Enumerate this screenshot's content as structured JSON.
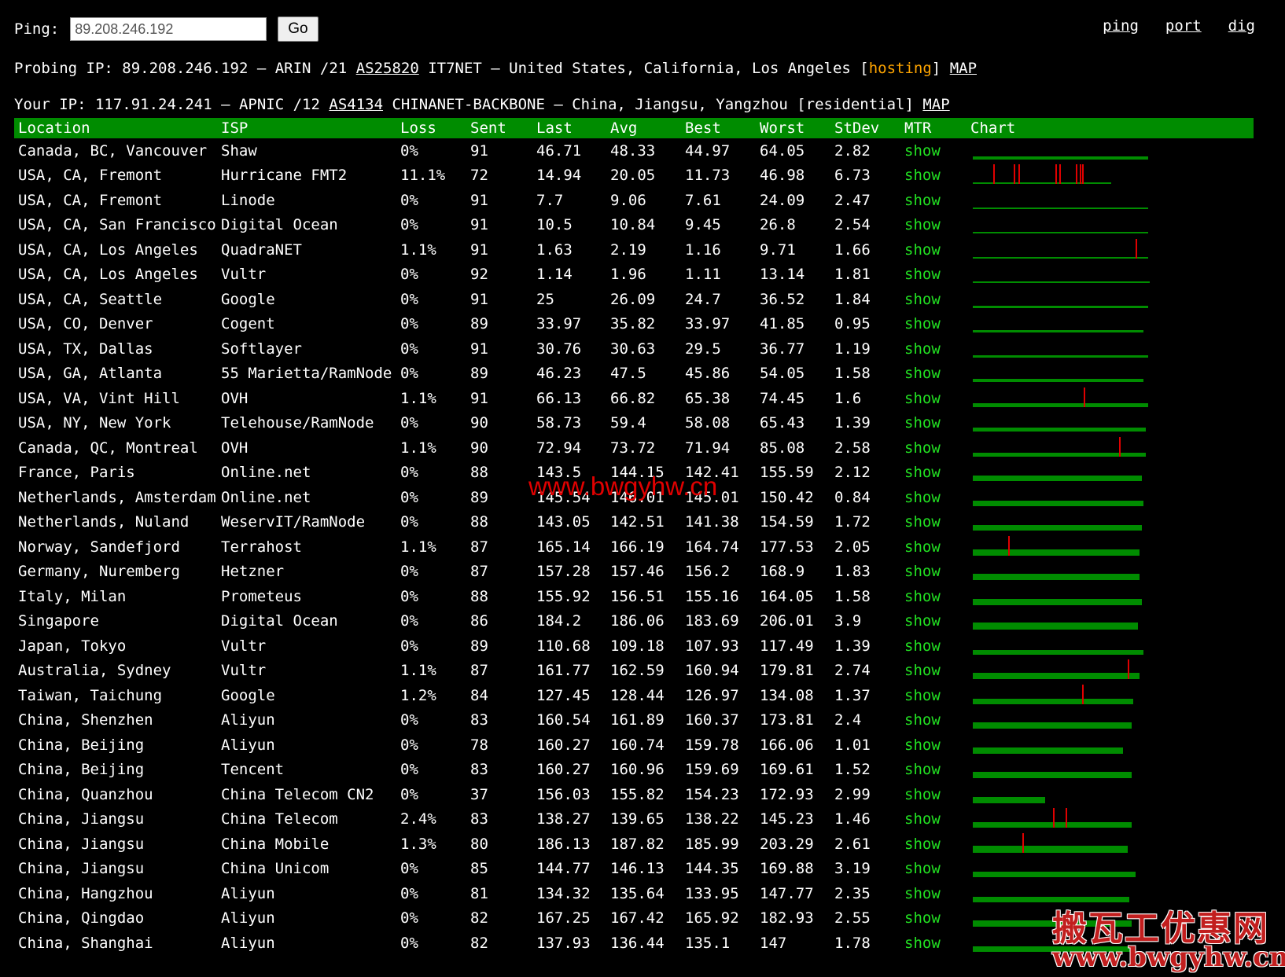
{
  "form": {
    "label": "Ping:",
    "input_value": "89.208.246.192",
    "go_label": "Go"
  },
  "nav": [
    "ping",
    "port",
    "dig"
  ],
  "probing": {
    "prefix": "Probing IP: 89.208.246.192 – ARIN /21 ",
    "as": "AS25820",
    "middle": " IT7NET – United States, California, Los Angeles [",
    "tag": "hosting",
    "after": "] ",
    "map": "MAP"
  },
  "your": {
    "prefix": "Your IP: 117.91.24.241 – APNIC /12 ",
    "as": "AS4134",
    "middle": " CHINANET-BACKBONE – China, Jiangsu, Yangzhou [residential] ",
    "map": "MAP"
  },
  "columns": [
    "Location",
    "ISP",
    "Loss",
    "Sent",
    "Last",
    "Avg",
    "Best",
    "Worst",
    "StDev",
    "MTR",
    "Chart"
  ],
  "colors": {
    "header_bg": "#008c00",
    "show_link": "#22e022",
    "chart_green": "#008c00",
    "chart_loss": "#e00000",
    "hosting": "#ffa500"
  },
  "rows": [
    {
      "location": "Canada, BC, Vancouver",
      "isp": "Shaw",
      "loss": "0%",
      "sent": "91",
      "last": "46.71",
      "avg": "48.33",
      "best": "44.97",
      "worst": "64.05",
      "stdev": "2.82",
      "mtr": "show",
      "chart": {
        "fill": 0.85,
        "thickness": 0.25,
        "spikes": []
      }
    },
    {
      "location": "USA, CA, Fremont",
      "isp": "Hurricane FMT2",
      "loss": "11.1%",
      "sent": "72",
      "last": "14.94",
      "avg": "20.05",
      "best": "11.73",
      "worst": "46.98",
      "stdev": "6.73",
      "mtr": "show",
      "chart": {
        "fill": 0.67,
        "thickness": 0.12,
        "spikes": [
          0.1,
          0.2,
          0.22,
          0.4,
          0.42,
          0.5,
          0.52,
          0.53
        ]
      }
    },
    {
      "location": "USA, CA, Fremont",
      "isp": "Linode",
      "loss": "0%",
      "sent": "91",
      "last": "7.7",
      "avg": "9.06",
      "best": "7.61",
      "worst": "24.09",
      "stdev": "2.47",
      "mtr": "show",
      "chart": {
        "fill": 0.85,
        "thickness": 0.08,
        "spikes": []
      }
    },
    {
      "location": "USA, CA, San Francisco",
      "isp": "Digital Ocean",
      "loss": "0%",
      "sent": "91",
      "last": "10.5",
      "avg": "10.84",
      "best": "9.45",
      "worst": "26.8",
      "stdev": "2.54",
      "mtr": "show",
      "chart": {
        "fill": 0.85,
        "thickness": 0.08,
        "spikes": []
      }
    },
    {
      "location": "USA, CA, Los Angeles",
      "isp": "QuadraNET",
      "loss": "1.1%",
      "sent": "91",
      "last": "1.63",
      "avg": "2.19",
      "best": "1.16",
      "worst": "9.71",
      "stdev": "1.66",
      "mtr": "show",
      "chart": {
        "fill": 0.85,
        "thickness": 0.06,
        "spikes": [
          0.79
        ]
      }
    },
    {
      "location": "USA, CA, Los Angeles",
      "isp": "Vultr",
      "loss": "0%",
      "sent": "92",
      "last": "1.14",
      "avg": "1.96",
      "best": "1.11",
      "worst": "13.14",
      "stdev": "1.81",
      "mtr": "show",
      "chart": {
        "fill": 0.86,
        "thickness": 0.06,
        "spikes": []
      }
    },
    {
      "location": "USA, CA, Seattle",
      "isp": "Google",
      "loss": "0%",
      "sent": "91",
      "last": "25",
      "avg": "26.09",
      "best": "24.7",
      "worst": "36.52",
      "stdev": "1.84",
      "mtr": "show",
      "chart": {
        "fill": 0.85,
        "thickness": 0.2,
        "spikes": []
      }
    },
    {
      "location": "USA, CO, Denver",
      "isp": "Cogent",
      "loss": "0%",
      "sent": "89",
      "last": "33.97",
      "avg": "35.82",
      "best": "33.97",
      "worst": "41.85",
      "stdev": "0.95",
      "mtr": "show",
      "chart": {
        "fill": 0.83,
        "thickness": 0.2,
        "spikes": []
      }
    },
    {
      "location": "USA, TX, Dallas",
      "isp": "Softlayer",
      "loss": "0%",
      "sent": "91",
      "last": "30.76",
      "avg": "30.63",
      "best": "29.5",
      "worst": "36.77",
      "stdev": "1.19",
      "mtr": "show",
      "chart": {
        "fill": 0.85,
        "thickness": 0.2,
        "spikes": []
      }
    },
    {
      "location": "USA, GA, Atlanta",
      "isp": "55 Marietta/RamNode",
      "loss": "0%",
      "sent": "89",
      "last": "46.23",
      "avg": "47.5",
      "best": "45.86",
      "worst": "54.05",
      "stdev": "1.58",
      "mtr": "show",
      "chart": {
        "fill": 0.83,
        "thickness": 0.25,
        "spikes": []
      }
    },
    {
      "location": "USA, VA, Vint Hill",
      "isp": "OVH",
      "loss": "1.1%",
      "sent": "91",
      "last": "66.13",
      "avg": "66.82",
      "best": "65.38",
      "worst": "74.45",
      "stdev": "1.6",
      "mtr": "show",
      "chart": {
        "fill": 0.85,
        "thickness": 0.3,
        "spikes": [
          0.54
        ]
      }
    },
    {
      "location": "USA, NY, New York",
      "isp": "Telehouse/RamNode",
      "loss": "0%",
      "sent": "90",
      "last": "58.73",
      "avg": "59.4",
      "best": "58.08",
      "worst": "65.43",
      "stdev": "1.39",
      "mtr": "show",
      "chart": {
        "fill": 0.84,
        "thickness": 0.3,
        "spikes": []
      }
    },
    {
      "location": "Canada, QC, Montreal",
      "isp": "OVH",
      "loss": "1.1%",
      "sent": "90",
      "last": "72.94",
      "avg": "73.72",
      "best": "71.94",
      "worst": "85.08",
      "stdev": "2.58",
      "mtr": "show",
      "chart": {
        "fill": 0.84,
        "thickness": 0.32,
        "spikes": [
          0.71
        ]
      }
    },
    {
      "location": "France, Paris",
      "isp": "Online.net",
      "loss": "0%",
      "sent": "88",
      "last": "143.5",
      "avg": "144.15",
      "best": "142.41",
      "worst": "155.59",
      "stdev": "2.12",
      "mtr": "show",
      "chart": {
        "fill": 0.82,
        "thickness": 0.45,
        "spikes": []
      }
    },
    {
      "location": "Netherlands, Amsterdam",
      "isp": "Online.net",
      "loss": "0%",
      "sent": "89",
      "last": "145.54",
      "avg": "146.01",
      "best": "145.01",
      "worst": "150.42",
      "stdev": "0.84",
      "mtr": "show",
      "chart": {
        "fill": 0.83,
        "thickness": 0.45,
        "spikes": []
      }
    },
    {
      "location": "Netherlands, Nuland",
      "isp": "WeservIT/RamNode",
      "loss": "0%",
      "sent": "88",
      "last": "143.05",
      "avg": "142.51",
      "best": "141.38",
      "worst": "154.59",
      "stdev": "1.72",
      "mtr": "show",
      "chart": {
        "fill": 0.82,
        "thickness": 0.45,
        "spikes": []
      }
    },
    {
      "location": "Norway, Sandefjord",
      "isp": "Terrahost",
      "loss": "1.1%",
      "sent": "87",
      "last": "165.14",
      "avg": "166.19",
      "best": "164.74",
      "worst": "177.53",
      "stdev": "2.05",
      "mtr": "show",
      "chart": {
        "fill": 0.81,
        "thickness": 0.5,
        "spikes": [
          0.17
        ]
      }
    },
    {
      "location": "Germany, Nuremberg",
      "isp": "Hetzner",
      "loss": "0%",
      "sent": "87",
      "last": "157.28",
      "avg": "157.46",
      "best": "156.2",
      "worst": "168.9",
      "stdev": "1.83",
      "mtr": "show",
      "chart": {
        "fill": 0.81,
        "thickness": 0.5,
        "spikes": []
      }
    },
    {
      "location": "Italy, Milan",
      "isp": "Prometeus",
      "loss": "0%",
      "sent": "88",
      "last": "155.92",
      "avg": "156.51",
      "best": "155.16",
      "worst": "164.05",
      "stdev": "1.58",
      "mtr": "show",
      "chart": {
        "fill": 0.82,
        "thickness": 0.5,
        "spikes": []
      }
    },
    {
      "location": "Singapore",
      "isp": "Digital Ocean",
      "loss": "0%",
      "sent": "86",
      "last": "184.2",
      "avg": "186.06",
      "best": "183.69",
      "worst": "206.01",
      "stdev": "3.9",
      "mtr": "show",
      "chart": {
        "fill": 0.8,
        "thickness": 0.55,
        "spikes": []
      }
    },
    {
      "location": "Japan, Tokyo",
      "isp": "Vultr",
      "loss": "0%",
      "sent": "89",
      "last": "110.68",
      "avg": "109.18",
      "best": "107.93",
      "worst": "117.49",
      "stdev": "1.39",
      "mtr": "show",
      "chart": {
        "fill": 0.83,
        "thickness": 0.4,
        "spikes": []
      }
    },
    {
      "location": "Australia, Sydney",
      "isp": "Vultr",
      "loss": "1.1%",
      "sent": "87",
      "last": "161.77",
      "avg": "162.59",
      "best": "160.94",
      "worst": "179.81",
      "stdev": "2.74",
      "mtr": "show",
      "chart": {
        "fill": 0.81,
        "thickness": 0.5,
        "spikes": [
          0.75
        ]
      }
    },
    {
      "location": "Taiwan, Taichung",
      "isp": "Google",
      "loss": "1.2%",
      "sent": "84",
      "last": "127.45",
      "avg": "128.44",
      "best": "126.97",
      "worst": "134.08",
      "stdev": "1.37",
      "mtr": "show",
      "chart": {
        "fill": 0.78,
        "thickness": 0.42,
        "spikes": [
          0.53
        ]
      }
    },
    {
      "location": "China, Shenzhen",
      "isp": "Aliyun",
      "loss": "0%",
      "sent": "83",
      "last": "160.54",
      "avg": "161.89",
      "best": "160.37",
      "worst": "173.81",
      "stdev": "2.4",
      "mtr": "show",
      "chart": {
        "fill": 0.77,
        "thickness": 0.5,
        "spikes": []
      }
    },
    {
      "location": "China, Beijing",
      "isp": "Aliyun",
      "loss": "0%",
      "sent": "78",
      "last": "160.27",
      "avg": "160.74",
      "best": "159.78",
      "worst": "166.06",
      "stdev": "1.01",
      "mtr": "show",
      "chart": {
        "fill": 0.73,
        "thickness": 0.5,
        "spikes": []
      }
    },
    {
      "location": "China, Beijing",
      "isp": "Tencent",
      "loss": "0%",
      "sent": "83",
      "last": "160.27",
      "avg": "160.96",
      "best": "159.69",
      "worst": "169.61",
      "stdev": "1.52",
      "mtr": "show",
      "chart": {
        "fill": 0.77,
        "thickness": 0.5,
        "spikes": []
      }
    },
    {
      "location": "China, Quanzhou",
      "isp": "China Telecom CN2",
      "loss": "0%",
      "sent": "37",
      "last": "156.03",
      "avg": "155.82",
      "best": "154.23",
      "worst": "172.93",
      "stdev": "2.99",
      "mtr": "show",
      "chart": {
        "fill": 0.35,
        "thickness": 0.5,
        "spikes": []
      }
    },
    {
      "location": "China, Jiangsu",
      "isp": "China Telecom",
      "loss": "2.4%",
      "sent": "83",
      "last": "138.27",
      "avg": "139.65",
      "best": "138.22",
      "worst": "145.23",
      "stdev": "1.46",
      "mtr": "show",
      "chart": {
        "fill": 0.77,
        "thickness": 0.45,
        "spikes": [
          0.39,
          0.45
        ]
      }
    },
    {
      "location": "China, Jiangsu",
      "isp": "China Mobile",
      "loss": "1.3%",
      "sent": "80",
      "last": "186.13",
      "avg": "187.82",
      "best": "185.99",
      "worst": "203.29",
      "stdev": "2.61",
      "mtr": "show",
      "chart": {
        "fill": 0.75,
        "thickness": 0.55,
        "spikes": [
          0.24
        ]
      }
    },
    {
      "location": "China, Jiangsu",
      "isp": "China Unicom",
      "loss": "0%",
      "sent": "85",
      "last": "144.77",
      "avg": "146.13",
      "best": "144.35",
      "worst": "169.88",
      "stdev": "3.19",
      "mtr": "show",
      "chart": {
        "fill": 0.79,
        "thickness": 0.45,
        "spikes": []
      }
    },
    {
      "location": "China, Hangzhou",
      "isp": "Aliyun",
      "loss": "0%",
      "sent": "81",
      "last": "134.32",
      "avg": "135.64",
      "best": "133.95",
      "worst": "147.77",
      "stdev": "2.35",
      "mtr": "show",
      "chart": {
        "fill": 0.76,
        "thickness": 0.45,
        "spikes": []
      }
    },
    {
      "location": "China, Qingdao",
      "isp": "Aliyun",
      "loss": "0%",
      "sent": "82",
      "last": "167.25",
      "avg": "167.42",
      "best": "165.92",
      "worst": "182.93",
      "stdev": "2.55",
      "mtr": "show",
      "chart": {
        "fill": 0.77,
        "thickness": 0.5,
        "spikes": []
      }
    },
    {
      "location": "China, Shanghai",
      "isp": "Aliyun",
      "loss": "0%",
      "sent": "82",
      "last": "137.93",
      "avg": "136.44",
      "best": "135.1",
      "worst": "147",
      "stdev": "1.78",
      "mtr": "show",
      "chart": {
        "fill": 0.77,
        "thickness": 0.45,
        "spikes": []
      }
    }
  ],
  "watermark": {
    "center": "www.bwgyhw.cn",
    "corner_cn": "搬瓦工优惠网",
    "corner_url": "www.bwgyhw.cn"
  }
}
